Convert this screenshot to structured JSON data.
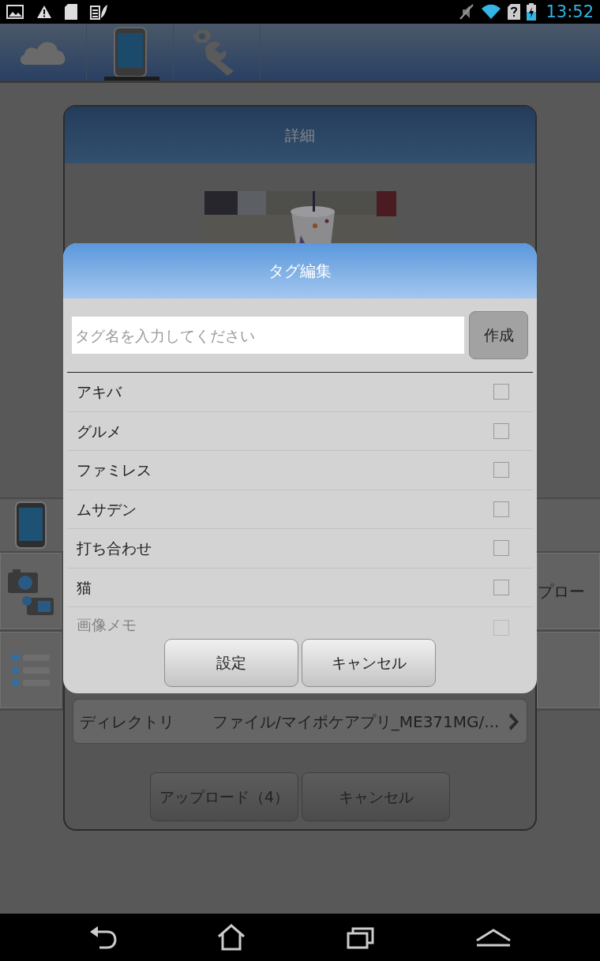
{
  "status_bar": {
    "time": "13:52"
  },
  "toolbar": {
    "tabs": [
      {
        "kind": "cloud",
        "selected": false
      },
      {
        "kind": "device",
        "selected": true
      },
      {
        "kind": "tools",
        "selected": false
      }
    ]
  },
  "back_screen": {
    "side_label": "プロー"
  },
  "detail_dialog": {
    "title": "詳細",
    "directory": {
      "label": "ディレクトリ",
      "value": "ファイル/マイポケアプリ_ME371MG/..."
    },
    "buttons": [
      "アップロード（4）",
      "キャンセル"
    ]
  },
  "tag_dialog": {
    "title": "タグ編集",
    "input": {
      "placeholder": "タグ名を入力してください"
    },
    "create_button": "作成",
    "tags": [
      {
        "name": "アキバ",
        "checked": false
      },
      {
        "name": "グルメ",
        "checked": false
      },
      {
        "name": "ファミレス",
        "checked": false
      },
      {
        "name": "ムサデン",
        "checked": false
      },
      {
        "name": "打ち合わせ",
        "checked": false
      },
      {
        "name": "猫",
        "checked": false
      },
      {
        "name": "画像メモ",
        "checked": false
      }
    ],
    "buttons": [
      "設定",
      "キャンセル"
    ]
  }
}
